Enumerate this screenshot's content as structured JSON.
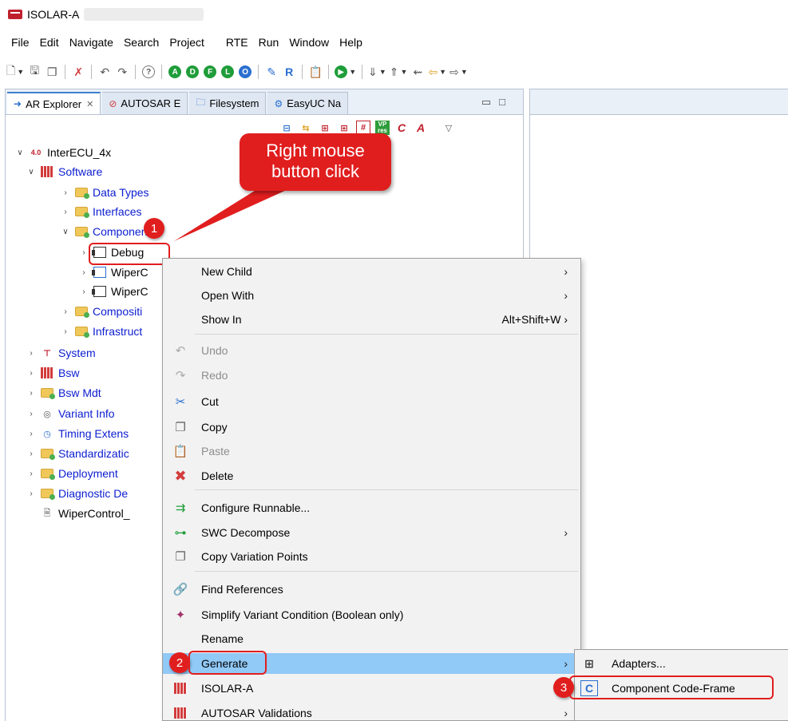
{
  "window": {
    "title": "ISOLAR-A"
  },
  "menubar": [
    "File",
    "Edit",
    "Navigate",
    "Search",
    "Project",
    "RTE",
    "Run",
    "Window",
    "Help"
  ],
  "toolbar": {
    "circle_buttons": [
      {
        "letter": "A",
        "color": "#1f9d3a"
      },
      {
        "letter": "D",
        "color": "#1f9d3a"
      },
      {
        "letter": "F",
        "color": "#1f9d3a"
      },
      {
        "letter": "L",
        "color": "#1f9d3a"
      },
      {
        "letter": "O",
        "color": "#2a6fd1"
      }
    ],
    "help_glyph": "?"
  },
  "tabs": [
    {
      "label": "AR Explorer",
      "active": true
    },
    {
      "label": "AUTOSAR E",
      "active": false
    },
    {
      "label": "Filesystem",
      "active": false
    },
    {
      "label": "EasyUC Na",
      "active": false
    }
  ],
  "view_tools": {
    "vp_label": "VP",
    "res_label": "res",
    "c_label": "C",
    "a_label": "A"
  },
  "tree": {
    "project": "InterECU_4x",
    "project_badge": "4.0",
    "software": "Software",
    "data_types": "Data Types",
    "interfaces": "Interfaces",
    "components": "Components",
    "debug": "Debug",
    "wiper1": "WiperC",
    "wiper2": "WiperC",
    "compositions": "Compositi",
    "infrastructure": "Infrastruct",
    "system": "System",
    "bsw": "Bsw",
    "bsw_mdt": "Bsw Mdt",
    "variant_info": "Variant Info",
    "timing": "Timing Extens",
    "standardization": "Standardizatic",
    "deployment": "Deployment",
    "diagnostic": "Diagnostic De",
    "wiper_file": "WiperControl_"
  },
  "context_menu": {
    "new_child": "New Child",
    "open_with": "Open With",
    "show_in": "Show In",
    "show_in_shortcut": "Alt+Shift+W",
    "undo": "Undo",
    "redo": "Redo",
    "cut": "Cut",
    "copy": "Copy",
    "paste": "Paste",
    "delete": "Delete",
    "configure_runnable": "Configure Runnable...",
    "swc_decompose": "SWC Decompose",
    "copy_variation_points": "Copy Variation Points",
    "find_references": "Find References",
    "simplify_variant": "Simplify Variant Condition (Boolean only)",
    "rename": "Rename",
    "generate": "Generate",
    "isolar_a": "ISOLAR-A",
    "autosar_validations": "AUTOSAR Validations"
  },
  "submenu": {
    "adapters": "Adapters...",
    "component_code_frame": "Component Code-Frame",
    "code_frame_icon": "C"
  },
  "annotations": {
    "callout": "Right mouse button click",
    "step1": "1",
    "step2": "2",
    "step3": "3",
    "accent": "#e11e1e"
  }
}
